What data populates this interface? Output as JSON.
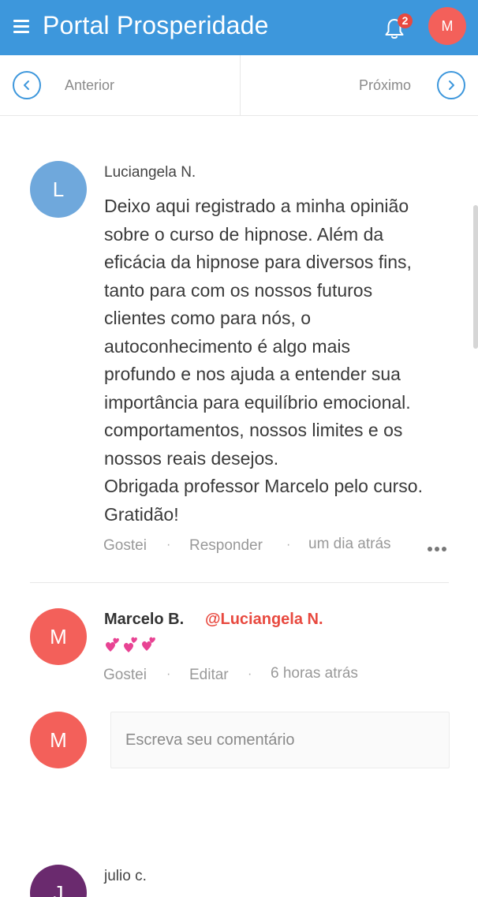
{
  "header": {
    "title": "Portal Prosperidade",
    "notification_count": "2",
    "user_initial": "M",
    "color": "#3d97dc"
  },
  "navigation": {
    "previous_label": "Anterior",
    "next_label": "Próximo"
  },
  "comments": [
    {
      "author": "Luciangela N.",
      "initial": "L",
      "avatar_color": "#6fa8dc",
      "lines": [
        "Deixo aqui registrado a minha opinião",
        "sobre o curso de hipnose. Além da",
        "eficácia da hipnose para diversos fins,",
        "tanto  para com os nossos futuros",
        "clientes como para nós, o",
        "autoconhecimento é algo mais",
        "profundo e nos ajuda a entender  sua",
        "importância para equilíbrio emocional.",
        "comportamentos, nossos limites e os",
        "nossos reais desejos.",
        "Obrigada professor Marcelo pelo curso.",
        "Gratidão!"
      ],
      "actions": {
        "like": "Gostei",
        "reply": "Responder",
        "time": "um dia atrás"
      },
      "replies": [
        {
          "author": "Marcelo B.",
          "initial": "M",
          "avatar_color": "#f3605a",
          "mention": "@Luciangela N.",
          "emoji": "💞💞💞",
          "actions": {
            "like": "Gostei",
            "edit": "Editar",
            "time": "6 horas atrás"
          }
        }
      ]
    },
    {
      "author": "julio c.",
      "initial": "J",
      "avatar_color": "#6a2a6e"
    }
  ],
  "comment_box": {
    "user_initial": "M",
    "placeholder": "Escreva seu comentário"
  },
  "separator_char": "·"
}
